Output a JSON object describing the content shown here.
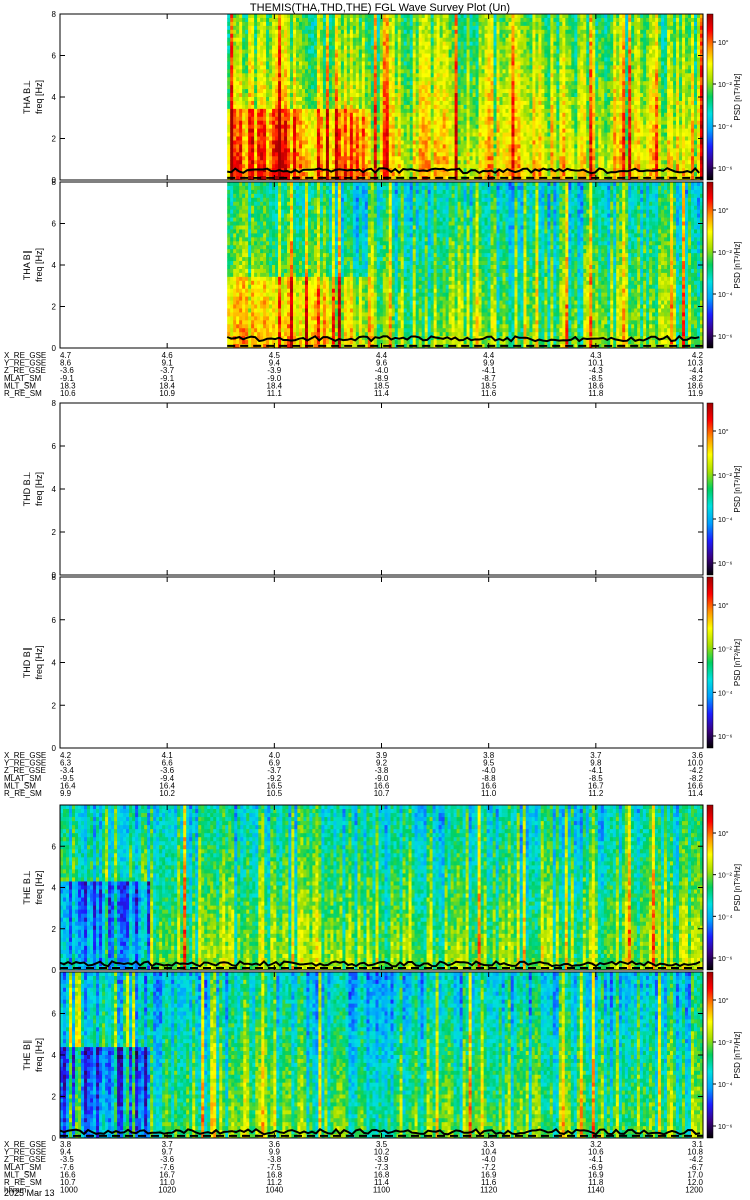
{
  "title": "THEMIS(THA,THD,THE) FGL Wave Survey Plot (Un)",
  "colorbar": {
    "label": "PSD [nT²/Hz]"
  },
  "colorscale": [
    "#000000",
    "#3a0080",
    "#1d1dff",
    "#00a0ff",
    "#00e0e0",
    "#00d060",
    "#a8e000",
    "#ffff00",
    "#ff9000",
    "#ff0000",
    "#a00000"
  ],
  "chart_data": [
    {
      "type": "heatmap",
      "probe": "THA",
      "component": "B⊥",
      "ylabel": "THA B⊥",
      "yunit": "freq [Hz]",
      "ylim": [
        0,
        8
      ],
      "yticks": [
        "0",
        "2",
        "4",
        "6",
        "8"
      ],
      "colorbar_ticks": [
        "10°",
        "10⁻²",
        "10⁻⁴",
        "10⁻⁶"
      ],
      "data_start_fraction": 0.26,
      "mean_level": 0.62,
      "cutoff_hz": 0.45,
      "dashed_line_hz": 0.1
    },
    {
      "type": "heatmap",
      "probe": "THA",
      "component": "B∥",
      "ylabel": "THA B∥",
      "yunit": "freq [Hz]",
      "ylim": [
        0,
        8
      ],
      "yticks": [
        "0",
        "2",
        "4",
        "6",
        "8"
      ],
      "colorbar_ticks": [
        "10°",
        "10⁻²",
        "10⁻⁴",
        "10⁻⁶"
      ],
      "data_start_fraction": 0.26,
      "mean_level": 0.5,
      "cutoff_hz": 0.45,
      "dashed_line_hz": 0.1
    },
    {
      "type": "heatmap",
      "probe": "THD",
      "component": "B⊥",
      "ylabel": "THD B⊥",
      "yunit": "freq [Hz]",
      "ylim": [
        0,
        8
      ],
      "yticks": [
        "0",
        "2",
        "4",
        "6",
        "8"
      ],
      "colorbar_ticks": [
        "10°",
        "10⁻²",
        "10⁻⁴",
        "10⁻⁶"
      ],
      "empty": true
    },
    {
      "type": "heatmap",
      "probe": "THD",
      "component": "B∥",
      "ylabel": "THD B∥",
      "yunit": "freq [Hz]",
      "ylim": [
        0,
        8
      ],
      "yticks": [
        "0",
        "2",
        "4",
        "6",
        "8"
      ],
      "colorbar_ticks": [
        "10°",
        "10⁻²",
        "10⁻⁴",
        "10⁻⁶"
      ],
      "empty": true
    },
    {
      "type": "heatmap",
      "probe": "THE",
      "component": "B⊥",
      "ylabel": "THE B⊥",
      "yunit": "freq [Hz]",
      "ylim": [
        0,
        8
      ],
      "yticks": [
        "0",
        "2",
        "4",
        "6"
      ],
      "colorbar_ticks": [
        "10°",
        "10⁻²",
        "10⁻⁴",
        "10⁻⁶"
      ],
      "data_start_fraction": 0.0,
      "mean_level": 0.5,
      "cutoff_hz": 0.3,
      "dashed_line_hz": 0.1
    },
    {
      "type": "heatmap",
      "probe": "THE",
      "component": "B∥",
      "ylabel": "THE B∥",
      "yunit": "freq [Hz]",
      "ylim": [
        0,
        8
      ],
      "yticks": [
        "0",
        "2",
        "4",
        "6"
      ],
      "colorbar_ticks": [
        "10°",
        "10⁻²",
        "10⁻⁴",
        "10⁻⁶"
      ],
      "data_start_fraction": 0.0,
      "mean_level": 0.46,
      "cutoff_hz": 0.3,
      "dashed_line_hz": 0.1
    }
  ],
  "ephemeris": [
    {
      "rows": [
        {
          "label": "X_RE_GSE",
          "values": [
            "4.7",
            "4.6",
            "4.5",
            "4.4",
            "4.4",
            "4.3",
            "4.2"
          ]
        },
        {
          "label": "Y_RE_GSE",
          "values": [
            "8.6",
            "9.1",
            "9.4",
            "9.6",
            "9.9",
            "10.1",
            "10.3"
          ]
        },
        {
          "label": "Z_RE_GSE",
          "values": [
            "-3.6",
            "-3.7",
            "-3.9",
            "-4.0",
            "-4.1",
            "-4.3",
            "-4.4"
          ]
        },
        {
          "label": "MLAT_SM",
          "values": [
            "-9.1",
            "-9.1",
            "-9.0",
            "-8.9",
            "-8.7",
            "-8.5",
            "-8.2"
          ]
        },
        {
          "label": "MLT_SM",
          "values": [
            "18.3",
            "18.4",
            "18.4",
            "18.5",
            "18.5",
            "18.6",
            "18.6"
          ]
        },
        {
          "label": "R_RE_SM",
          "values": [
            "10.6",
            "10.9",
            "11.1",
            "11.4",
            "11.6",
            "11.8",
            "11.9"
          ]
        }
      ]
    },
    {
      "rows": [
        {
          "label": "X_RE_GSE",
          "values": [
            "4.2",
            "4.1",
            "4.0",
            "3.9",
            "3.8",
            "3.7",
            "3.6"
          ]
        },
        {
          "label": "Y_RE_GSE",
          "values": [
            "6.3",
            "6.6",
            "6.9",
            "9.2",
            "9.5",
            "9.8",
            "10.0"
          ]
        },
        {
          "label": "Z_RE_GSE",
          "values": [
            "-3.4",
            "-3.6",
            "-3.7",
            "-3.8",
            "-4.0",
            "-4.1",
            "-4.2"
          ]
        },
        {
          "label": "MLAT_SM",
          "values": [
            "-9.5",
            "-9.4",
            "-9.2",
            "-9.0",
            "-8.8",
            "-8.5",
            "-8.2"
          ]
        },
        {
          "label": "MLT_SM",
          "values": [
            "16.4",
            "16.4",
            "16.5",
            "16.6",
            "16.6",
            "16.7",
            "16.6"
          ]
        },
        {
          "label": "R_RE_SM",
          "values": [
            "9.9",
            "10.2",
            "10.5",
            "10.7",
            "11.0",
            "11.2",
            "11.4"
          ]
        }
      ]
    },
    {
      "rows": [
        {
          "label": "X_RE_GSE",
          "values": [
            "3.8",
            "3.7",
            "3.6",
            "3.5",
            "3.3",
            "3.2",
            "3.1"
          ]
        },
        {
          "label": "Y_RE_GSE",
          "values": [
            "9.4",
            "9.7",
            "9.9",
            "10.2",
            "10.4",
            "10.6",
            "10.8"
          ]
        },
        {
          "label": "Z_RE_GSE",
          "values": [
            "-3.5",
            "-3.6",
            "-3.8",
            "-3.9",
            "-4.0",
            "-4.1",
            "-4.2"
          ]
        },
        {
          "label": "MLAT_SM",
          "values": [
            "-7.6",
            "-7.6",
            "-7.5",
            "-7.3",
            "-7.2",
            "-6.9",
            "-6.7"
          ]
        },
        {
          "label": "MLT_SM",
          "values": [
            "16.6",
            "16.7",
            "16.8",
            "16.8",
            "16.9",
            "16.9",
            "17.0"
          ]
        },
        {
          "label": "R_RE_SM",
          "values": [
            "10.7",
            "11.0",
            "11.2",
            "11.4",
            "11.6",
            "11.8",
            "12.0"
          ]
        },
        {
          "label": "hhmm",
          "values": [
            "1000",
            "1020",
            "1040",
            "1100",
            "1120",
            "1140",
            "1200"
          ]
        }
      ]
    }
  ],
  "date_label": "2025 Mar 13"
}
